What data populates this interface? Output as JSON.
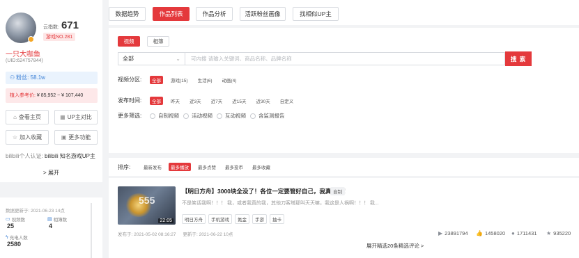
{
  "profile": {
    "score_label": "云指数:",
    "score_value": "671",
    "rank": "游戏NO.281",
    "name": "一只大咖鱼",
    "uid": "(UID:624757844)",
    "fans": "粉丝: 58.1w",
    "price_label": "植入参考价:",
    "price_value": "¥ 85,952 ~ ¥ 107,440",
    "buttons": {
      "home": "查看主页",
      "compare": "UP主对比",
      "favorite": "加入收藏",
      "more": "更多功能"
    },
    "cert_label": "bilibili个人认证:",
    "cert_value": "bilibili 知名游戏UP主",
    "expand": "> 展开",
    "update_time": "数据更新于: 2021-06-23 14点",
    "stats": [
      {
        "label": "视频数",
        "value": "25"
      },
      {
        "label": "相簿数",
        "value": "4"
      },
      {
        "label": "充电人数",
        "value": "2580"
      }
    ]
  },
  "tabs": [
    {
      "label": "数据趋势",
      "active": false
    },
    {
      "label": "作品列表",
      "active": true
    },
    {
      "label": "作品分析",
      "active": false
    },
    {
      "label": "活跃粉丝画像",
      "active": false
    },
    {
      "label": "找相似UP主",
      "active": false
    }
  ],
  "filters": {
    "media_tabs": {
      "video": "视频",
      "album": "相簿"
    },
    "category_select": "全部",
    "search_placeholder": "可内搜 请输入关键词、商品名称、品牌名称",
    "search_button": "搜 索",
    "partition_label": "视频分区:",
    "partitions": [
      {
        "label": "全部",
        "on": true
      },
      {
        "label": "游戏(15)",
        "on": false
      },
      {
        "label": "生活(6)",
        "on": false
      },
      {
        "label": "动画(4)",
        "on": false
      }
    ],
    "time_label": "发布时间:",
    "times": [
      {
        "label": "全部",
        "on": true
      },
      {
        "label": "昨天",
        "on": false
      },
      {
        "label": "近3天",
        "on": false
      },
      {
        "label": "近7天",
        "on": false
      },
      {
        "label": "近15天",
        "on": false
      },
      {
        "label": "近30天",
        "on": false
      },
      {
        "label": "自定义",
        "on": false
      }
    ],
    "more_label": "更多筛选:",
    "checks": [
      "自制视频",
      "活动视频",
      "互动视频",
      "含监测报告"
    ]
  },
  "sort": {
    "label": "排序:",
    "options": [
      {
        "label": "最新发布",
        "on": false
      },
      {
        "label": "最多播放",
        "on": true
      },
      {
        "label": "最多点赞",
        "on": false
      },
      {
        "label": "最多投币",
        "on": false
      },
      {
        "label": "最多收藏",
        "on": false
      }
    ]
  },
  "video": {
    "duration": "22:05",
    "title": "【明日方舟】3000块全没了！各位一定要管好自己，我真服了！",
    "type": "自制",
    "desc": "不是笑话我啊！！！ 我，或者我真的我，其他刀客塔那叫天天嘛，我这是人祸啊！！！ 我...",
    "tags": [
      "明日方舟",
      "手机游戏",
      "氪金",
      "手游",
      "抽卡"
    ],
    "publish_time": "发布于: 2021-05-02 08:16:27",
    "update_time": "更新于: 2021-06-22 10点",
    "metrics": {
      "plays": "23891794",
      "likes": "1458020",
      "coins": "1711431",
      "favorites": "935220"
    },
    "more_comments": "展开精选20条精选评论 >"
  }
}
